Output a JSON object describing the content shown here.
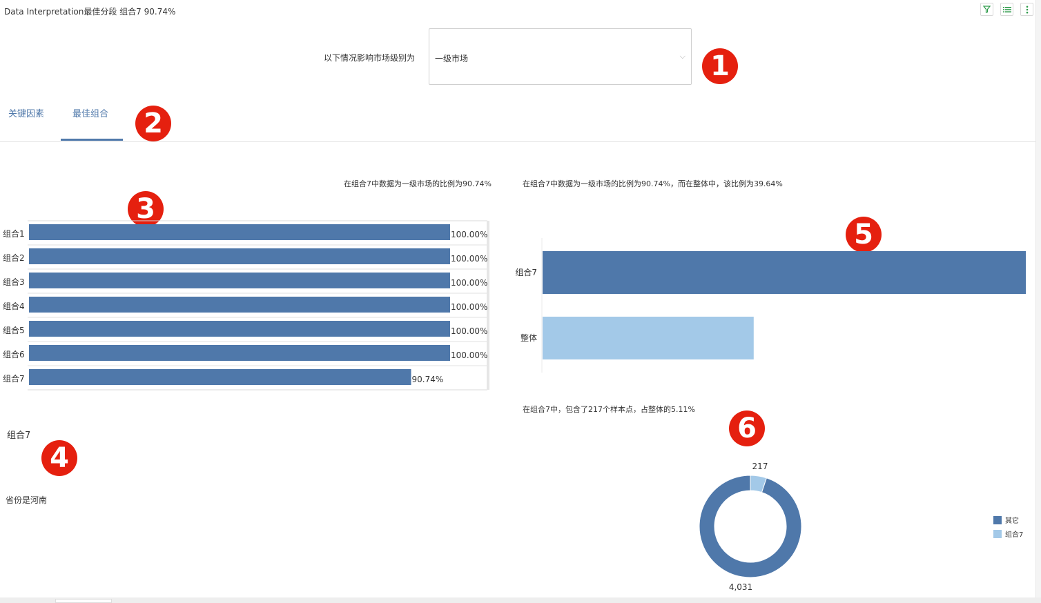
{
  "window": {
    "title": "Data Interpretation最佳分段 组合7 90.74%"
  },
  "toolbar": {
    "icons": [
      "filter-icon",
      "list-icon",
      "more-icon"
    ]
  },
  "filter": {
    "label": "以下情况影响市场级别为",
    "value": "一级市场"
  },
  "tabs": [
    {
      "label": "关键因素"
    },
    {
      "label": "最佳组合"
    }
  ],
  "active_tab": 1,
  "badges": [
    "1",
    "2",
    "3",
    "4",
    "5",
    "6"
  ],
  "charts_text": {
    "ratio_caption": "在组合7中数据为一级市场的比例为90.74%",
    "compare_caption": "在组合7中数据为一级市场的比例为90.74%，而在整体中，该比例为39.64%",
    "sample_caption": "在组合7中，包含了217个样本点，占整体的5.11%"
  },
  "segment": {
    "title": "组合7",
    "condition": "省份是河南"
  },
  "colors": {
    "dark_blue": "#4f78aa",
    "light_blue": "#a3c9e8",
    "badge_red": "#e5200f"
  },
  "chart_data": [
    {
      "type": "bar",
      "orientation": "horizontal",
      "categories": [
        "组合1",
        "组合2",
        "组合3",
        "组合4",
        "组合5",
        "组合6",
        "组合7"
      ],
      "values": [
        100.0,
        100.0,
        100.0,
        100.0,
        100.0,
        100.0,
        90.74
      ],
      "labels": [
        "100.00%",
        "100.00%",
        "100.00%",
        "100.00%",
        "100.00%",
        "100.00%",
        "90.74%"
      ],
      "xlim": [
        0,
        100
      ]
    },
    {
      "type": "bar",
      "orientation": "horizontal",
      "categories": [
        "组合7",
        "整体"
      ],
      "values": [
        90.74,
        39.64
      ],
      "xlim": [
        0,
        90.74
      ]
    },
    {
      "type": "pie",
      "donut": true,
      "categories": [
        "其它",
        "组合7"
      ],
      "values": [
        4031,
        217
      ],
      "labels": [
        "4,031",
        "217"
      ],
      "legend": "right"
    }
  ]
}
